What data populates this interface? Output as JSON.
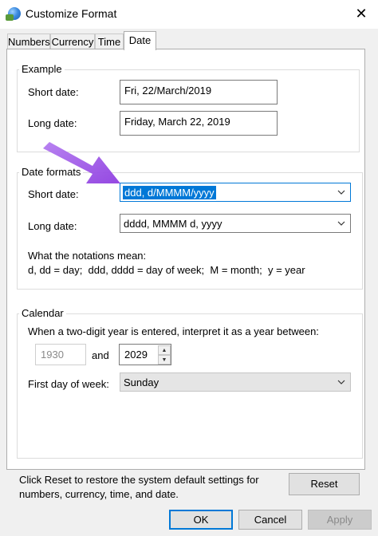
{
  "window": {
    "title": "Customize Format",
    "close_glyph": "✕"
  },
  "tabs": [
    {
      "label": "Numbers"
    },
    {
      "label": "Currency"
    },
    {
      "label": "Time"
    },
    {
      "label": "Date"
    }
  ],
  "example": {
    "group_title": "Example",
    "short_label": "Short date:",
    "short_value": "Fri, 22/March/2019",
    "long_label": "Long date:",
    "long_value": "Friday, March 22, 2019"
  },
  "date_formats": {
    "group_title": "Date formats",
    "short_label": "Short date:",
    "short_value": "ddd, d/MMMM/yyyy",
    "long_label": "Long date:",
    "long_value": "dddd, MMMM d, yyyy",
    "notation_title": "What the notations mean:",
    "notation_text": "d, dd = day;  ddd, dddd = day of week;  M = month;  y = year"
  },
  "calendar": {
    "group_title": "Calendar",
    "two_digit_text": "When a two-digit year is entered, interpret it as a year between:",
    "year_start": "1930",
    "and_label": "and",
    "year_end": "2029",
    "first_day_label": "First day of week:",
    "first_day_value": "Sunday"
  },
  "footer": {
    "reset_text_line1": "Click Reset to restore the system default settings for",
    "reset_text_line2": "numbers, currency, time, and date.",
    "reset_button": "Reset",
    "ok_button": "OK",
    "cancel_button": "Cancel",
    "apply_button": "Apply"
  },
  "colors": {
    "accent": "#0078d7",
    "annotation_arrow": "#a05ce0"
  }
}
